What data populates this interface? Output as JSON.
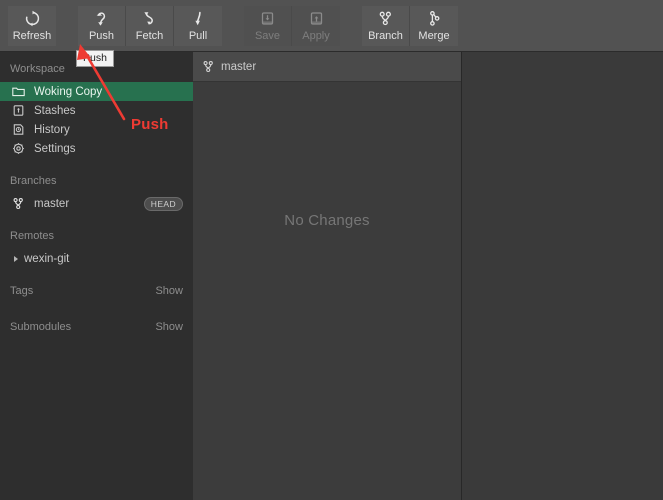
{
  "toolbar": {
    "groups": [
      {
        "name": "sync-group",
        "buttons": [
          {
            "label": "Refresh",
            "icon": "refresh-icon",
            "disabled": false
          }
        ]
      },
      {
        "name": "remote-group",
        "buttons": [
          {
            "label": "Push",
            "icon": "push-icon",
            "disabled": false
          },
          {
            "label": "Fetch",
            "icon": "fetch-icon",
            "disabled": false
          },
          {
            "label": "Pull",
            "icon": "pull-icon",
            "disabled": false
          }
        ]
      },
      {
        "name": "stash-group",
        "buttons": [
          {
            "label": "Save",
            "icon": "stash-save-icon",
            "disabled": true
          },
          {
            "label": "Apply",
            "icon": "stash-apply-icon",
            "disabled": true
          }
        ]
      },
      {
        "name": "branch-group",
        "buttons": [
          {
            "label": "Branch",
            "icon": "branch-icon",
            "disabled": false
          },
          {
            "label": "Merge",
            "icon": "merge-icon",
            "disabled": false
          }
        ]
      }
    ]
  },
  "sidebar": {
    "workspace": {
      "title": "Workspace",
      "items": [
        {
          "label": "Woking Copy",
          "icon": "folder-icon",
          "selected": true
        },
        {
          "label": "Stashes",
          "icon": "stash-icon",
          "selected": false
        },
        {
          "label": "History",
          "icon": "history-icon",
          "selected": false
        },
        {
          "label": "Settings",
          "icon": "gear-icon",
          "selected": false
        }
      ]
    },
    "branches": {
      "title": "Branches",
      "items": [
        {
          "label": "master",
          "icon": "branch-icon",
          "badge": "HEAD"
        }
      ]
    },
    "remotes": {
      "title": "Remotes",
      "items": [
        {
          "label": "wexin-git",
          "icon": "disclosure-triangle-icon"
        }
      ]
    },
    "tags": {
      "title": "Tags",
      "action": "Show"
    },
    "submodules": {
      "title": "Submodules",
      "action": "Show"
    }
  },
  "main": {
    "branch_bar": {
      "label": "master",
      "icon": "branch-icon"
    },
    "empty_state": "No Changes"
  },
  "annotations": {
    "tooltip": "Push",
    "callout_label": "Push",
    "callout_color": "#ee3b33"
  },
  "colors": {
    "toolbar_bg": "#525252",
    "sidebar_bg": "#2e2e2e",
    "middle_bg": "#3c3c3c",
    "right_bg": "#3a3a3a",
    "selection_green": "#27714f",
    "accent_red": "#ee3b33"
  }
}
